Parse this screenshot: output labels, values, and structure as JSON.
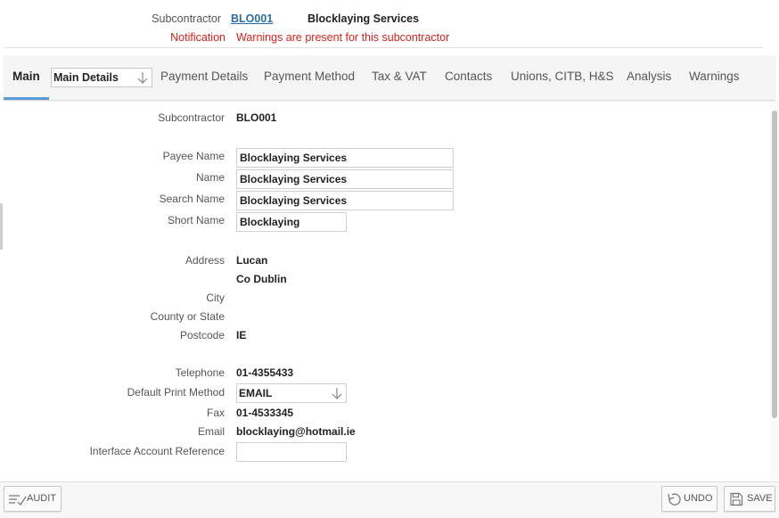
{
  "header": {
    "subcontractor_label": "Subcontractor",
    "subcontractor_code": "BLO001",
    "subcontractor_name": "Blocklaying Services",
    "notification_label": "Notification",
    "notification_text": "Warnings are present for this subcontractor",
    "warning_color": "#d9211d",
    "link_color": "#2e6da4"
  },
  "tabs": {
    "main": "Main",
    "main_details_select": "Main Details",
    "payment_details": "Payment Details",
    "payment_method": "Payment Method",
    "tax_vat": "Tax & VAT",
    "contacts": "Contacts",
    "unions": "Unions, CITB, H&S",
    "analysis": "Analysis",
    "warnings": "Warnings",
    "active_underline_color": "#5b9bd5"
  },
  "form": {
    "subcontractor": {
      "label": "Subcontractor",
      "value": "BLO001"
    },
    "payee_name": {
      "label": "Payee Name",
      "value": "Blocklaying Services"
    },
    "name": {
      "label": "Name",
      "value": "Blocklaying Services"
    },
    "search_name": {
      "label": "Search Name",
      "value": "Blocklaying Services"
    },
    "short_name": {
      "label": "Short Name",
      "value": "Blocklaying"
    },
    "address": {
      "label": "Address",
      "line1": "Lucan",
      "line2": "Co Dublin"
    },
    "city": {
      "label": "City",
      "value": ""
    },
    "county": {
      "label": "County or State",
      "value": ""
    },
    "postcode": {
      "label": "Postcode",
      "value": "IE"
    },
    "telephone": {
      "label": "Telephone",
      "value": "01-4355433"
    },
    "print_method": {
      "label": "Default Print Method",
      "value": "EMAIL"
    },
    "fax": {
      "label": "Fax",
      "value": "01-4533345"
    },
    "email": {
      "label": "Email",
      "value": "blocklaying@hotmail.ie"
    },
    "interface_ref": {
      "label": "Interface Account Reference",
      "value": ""
    }
  },
  "footer": {
    "audit_label": "AUDIT",
    "audit_icon": "audit-list-icon",
    "undo_label": "UNDO",
    "undo_icon": "undo-icon",
    "save_label": "SAVE",
    "save_icon": "floppy-disk-icon"
  }
}
